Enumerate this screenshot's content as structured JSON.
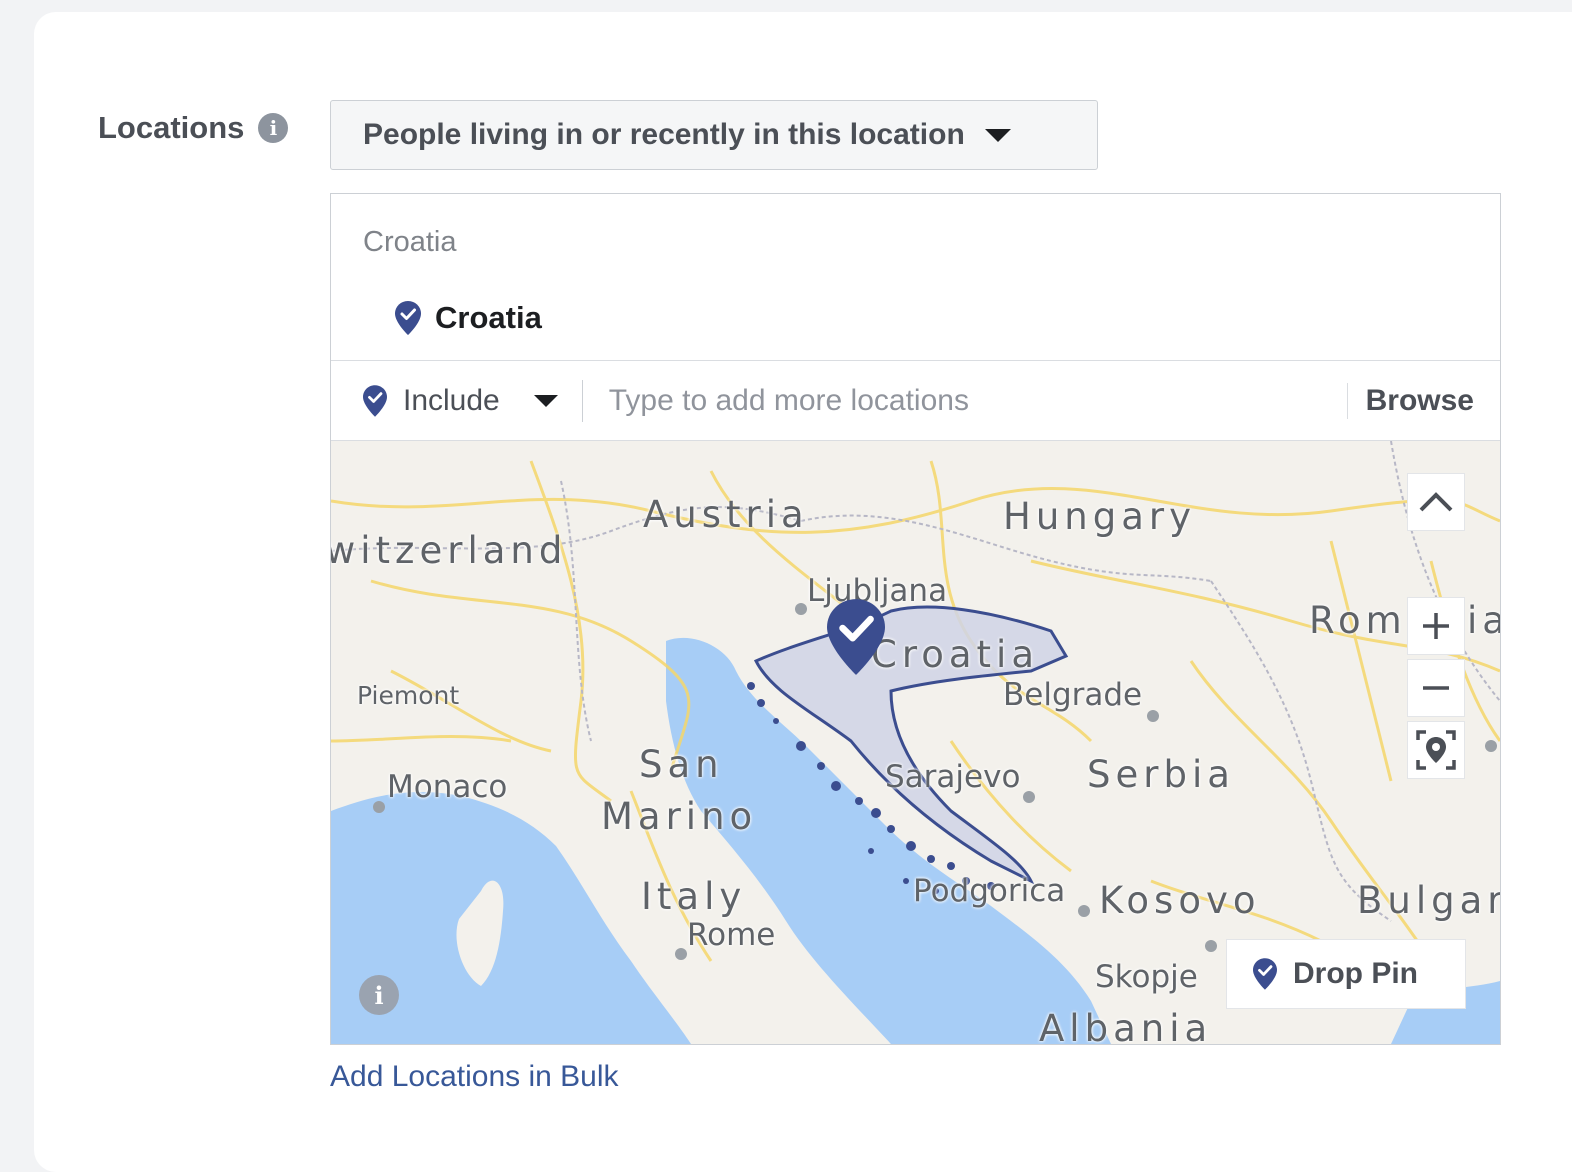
{
  "locations_label": "Locations",
  "location_type": {
    "selected": "People living in or recently in this location"
  },
  "selected_locations": {
    "group_title": "Croatia",
    "items": [
      "Croatia"
    ]
  },
  "entry": {
    "include_label": "Include",
    "placeholder": "Type to add more locations",
    "browse_label": "Browse"
  },
  "map": {
    "countries": [
      "witzerland",
      "Austria",
      "Hungary",
      "Rom",
      "ia",
      "San",
      "Marino",
      "Italy",
      "Serbia",
      "Kosovo",
      "Bulgar",
      "Albania"
    ],
    "highlighted_country": "Croatia",
    "cities": [
      "Ljubljana",
      "Belgrade",
      "Sarajevo",
      "Monaco",
      "Rome",
      "Podgorica",
      "Skopje"
    ],
    "regions": [
      "Piemont"
    ],
    "drop_pin_label": "Drop Pin",
    "colors": {
      "water": "#a7cdf6",
      "land": "#f3f1ec",
      "selection": "#3b4d8f",
      "roads": "#f5d66a"
    }
  },
  "bulk_link": "Add Locations in Bulk"
}
